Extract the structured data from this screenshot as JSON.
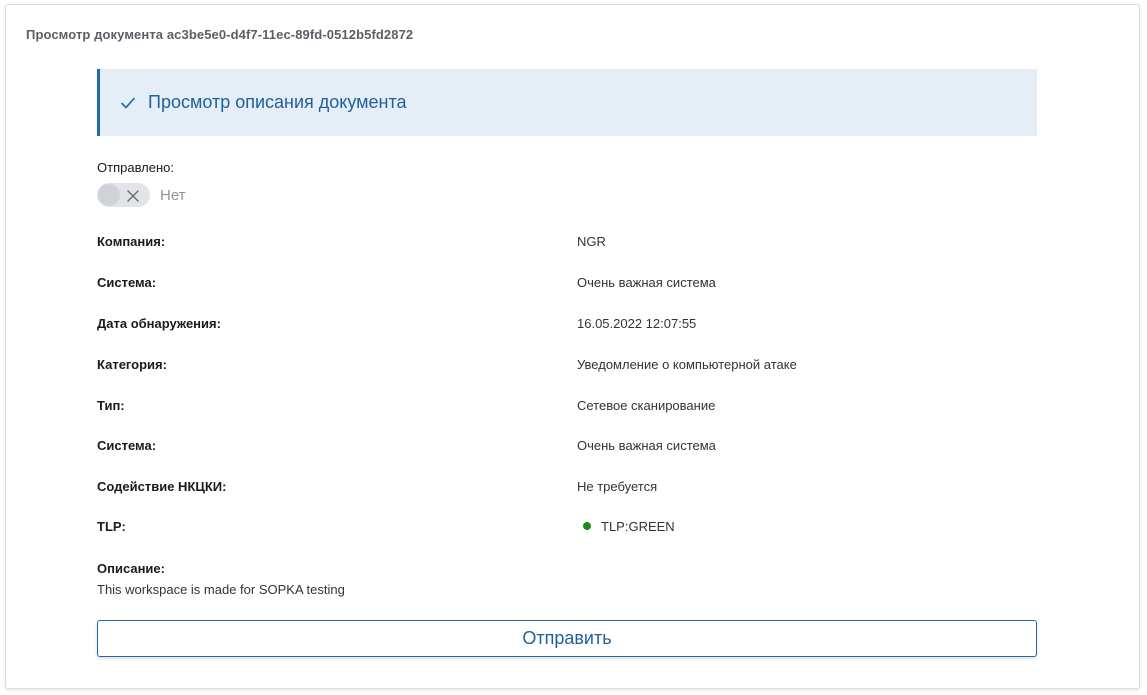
{
  "card": {
    "title": "Просмотр документа ac3be5e0-d4f7-11ec-89fd-0512b5fd2872"
  },
  "notice": {
    "icon": "check-icon",
    "text": "Просмотр описания документа",
    "accent_color": "#2168a8",
    "background_color": "#e5eef7"
  },
  "sent": {
    "label": "Отправлено:",
    "toggle_state": false,
    "toggle_icon": "x-icon",
    "toggle_text": "Нет"
  },
  "fields": [
    {
      "label": "Компания:",
      "value": "NGR"
    },
    {
      "label": "Система:",
      "value": "Очень важная система"
    },
    {
      "label": "Дата обнаружения:",
      "value": "16.05.2022 12:07:55"
    },
    {
      "label": "Категория:",
      "value": "Уведомление о компьютерной атаке"
    },
    {
      "label": "Тип:",
      "value": "Сетевое сканирование"
    },
    {
      "label": "Система:",
      "value": "Очень важная система"
    },
    {
      "label": "Содействие НКЦКИ:",
      "value": "Не требуется"
    },
    {
      "label": "TLP:",
      "value": "TLP:GREEN",
      "status_color": "#1f8a1f"
    }
  ],
  "description": {
    "label": "Описание:",
    "text": "This workspace is made for SOPKA testing"
  },
  "actions": {
    "submit_label": "Отправить"
  }
}
